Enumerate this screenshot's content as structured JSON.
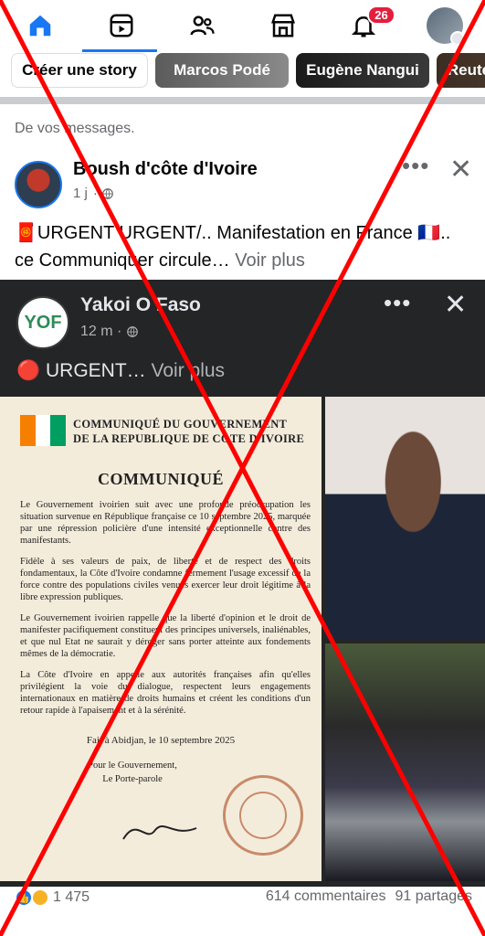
{
  "nav": {
    "items": [
      {
        "name": "home",
        "active": true
      },
      {
        "name": "reels"
      },
      {
        "name": "friends"
      },
      {
        "name": "marketplace"
      },
      {
        "name": "notifications",
        "badge": "26"
      },
      {
        "name": "profile"
      }
    ],
    "accent_color": "#1877f2",
    "badge_color": "#e41e3f"
  },
  "stories": {
    "create_label": "Créer une story",
    "cards": [
      "Marcos Podé",
      "Eugène Nangui",
      "Reuters Amour"
    ]
  },
  "feed": {
    "section_label": "De vos messages."
  },
  "post": {
    "author": "Boush d'côte d'Ivoire",
    "time": "1 j",
    "text": "🧧URGENT URGENT/.. Manifestation en France 🇫🇷.. ce Communiquer circule…",
    "see_more": "Voir plus",
    "more_icon": "•••",
    "close_icon": "✕"
  },
  "shared_post": {
    "author": "Yakoi O Faso",
    "avatar_text": "YOF",
    "time": "12 m",
    "text": "🔴 URGENT…",
    "see_more": "Voir plus",
    "more_icon": "•••",
    "close_icon": "✕"
  },
  "document": {
    "header_line1": "COMMUNIQUÉ DU GOUVERNEMENT",
    "header_line2": "DE LA REPUBLIQUE DE CÔTE D'IVOIRE",
    "title": "COMMUNIQUÉ",
    "p1": "Le Gouvernement ivoirien suit avec une profonde préoccupation les situation survenue en République française ce 10 septembre 2025, marquée par une répression policière d'une intensité exceptionnelle contre des manifestants.",
    "p2": "Fidèle à ses valeurs de paix, de liberté et de respect des droits fondamentaux, la Côte d'Ivoire condamne fermement l'usage excessif de la force contre des populations civiles venues exercer leur droit légitime à la libre expression publiques.",
    "p3": "Le Gouvernement ivoirien rappelle que la liberté d'opinion et le droit de manifester pacifiquement constituent des principes universels, inaliénables, et que nul Etat ne saurait y déroger sans porter atteinte aux fondements mêmes de la démocratie.",
    "p4": "La Côte d'Ivoire en appelle aux autorités françaises afin qu'elles privilégient la voie du dialogue, respectent leurs engagements internationaux en matière de droits humains et créent les conditions d'un retour rapide à l'apaisement et à la sérénité.",
    "date": "Fait à Abidjan, le 10 septembre 2025",
    "sign1": "Pour le Gouvernement,",
    "sign2": "Le Porte-parole",
    "flag_colors": [
      "#f77f00",
      "#ffffff",
      "#009e60"
    ]
  },
  "engagement": {
    "reaction_count": "1 475",
    "comments": "614 commentaires",
    "shares": "91 partages"
  },
  "overlay": {
    "type": "red-x",
    "color": "#ff0000"
  }
}
